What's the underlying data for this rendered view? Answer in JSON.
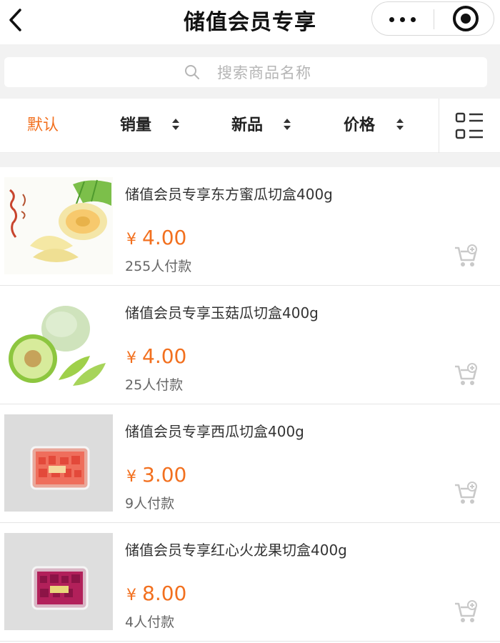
{
  "header": {
    "title": "储值会员专享",
    "back_icon": "chevron-left-icon",
    "more_icon": "more-dots-icon",
    "close_icon": "target-close-icon"
  },
  "search": {
    "placeholder": "搜索商品名称",
    "icon": "search-icon"
  },
  "sort": {
    "items": [
      {
        "label": "默认",
        "active": true
      },
      {
        "label": "销量",
        "active": false
      },
      {
        "label": "新品",
        "active": false
      },
      {
        "label": "价格",
        "active": false
      }
    ],
    "layout_icon": "grid-list-toggle-icon"
  },
  "colors": {
    "accent": "#f2701f",
    "text": "#333333",
    "muted": "#666666",
    "background": "#f2f2f2"
  },
  "products": [
    {
      "name": "储值会员专享东方蜜瓜切盒400g",
      "currency": "¥",
      "price": "4.00",
      "sold": "255人付款",
      "image": "honeydew-melon-image",
      "cart_icon": "add-to-cart-icon"
    },
    {
      "name": "储值会员专享玉菇瓜切盒400g",
      "currency": "¥",
      "price": "4.00",
      "sold": "25人付款",
      "image": "green-melon-image",
      "cart_icon": "add-to-cart-icon"
    },
    {
      "name": "储值会员专享西瓜切盒400g",
      "currency": "¥",
      "price": "3.00",
      "sold": "9人付款",
      "image": "watermelon-box-image",
      "cart_icon": "add-to-cart-icon"
    },
    {
      "name": "储值会员专享红心火龙果切盒400g",
      "currency": "¥",
      "price": "8.00",
      "sold": "4人付款",
      "image": "dragonfruit-box-image",
      "cart_icon": "add-to-cart-icon"
    }
  ]
}
